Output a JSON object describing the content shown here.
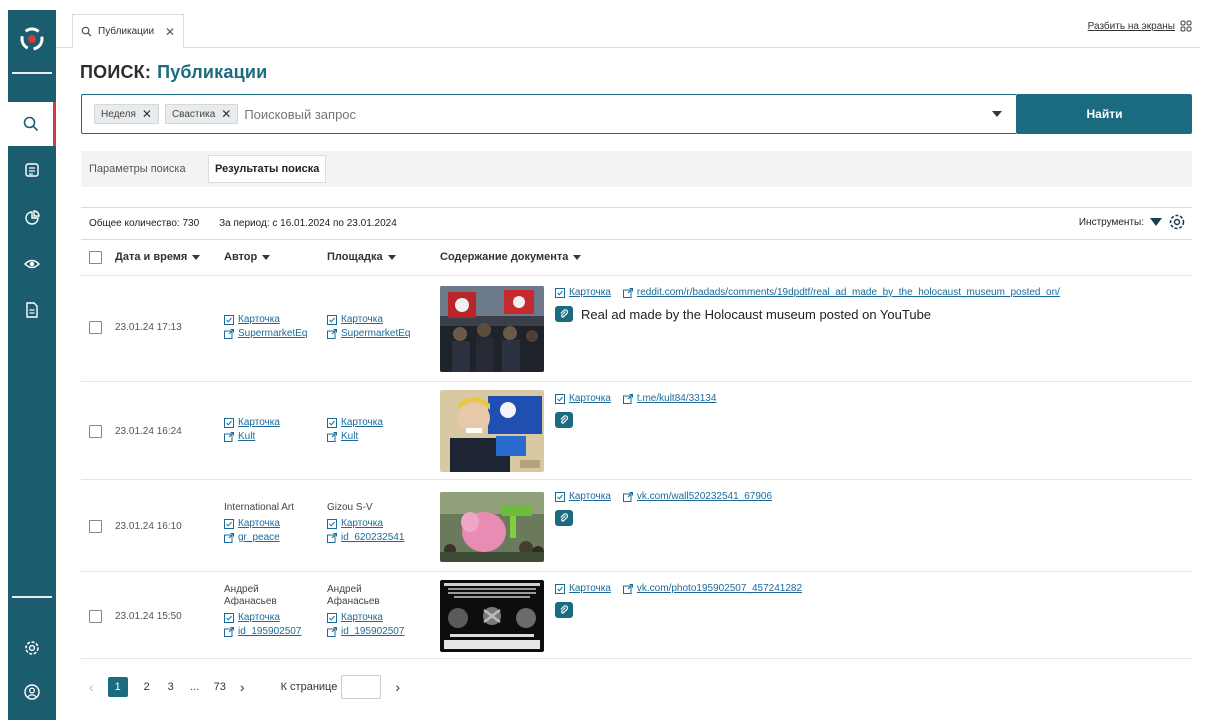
{
  "tab": {
    "label": "Публикации",
    "close": "✕"
  },
  "split": {
    "label": "Разбить на экраны"
  },
  "title": {
    "prefix": "ПОИСК:",
    "section": "Публикации"
  },
  "search": {
    "chips": [
      {
        "label": "Неделя",
        "close": "✕"
      },
      {
        "label": "Свастика",
        "close": "✕"
      }
    ],
    "placeholder": "Поисковый запрос",
    "button": "Найти"
  },
  "subtabs": {
    "params": "Параметры поиска",
    "results": "Результаты поиска"
  },
  "summary": {
    "total": "Общее количество: 730",
    "period": "За период: с 16.01.2024 по 23.01.2024",
    "tools": "Инструменты:"
  },
  "columns": {
    "datetime": "Дата и время",
    "author": "Автор",
    "platform": "Площадка",
    "content": "Содержание документа"
  },
  "card_label": "Карточка",
  "rows": [
    {
      "date": "23.01.24 17:13",
      "author_name": "",
      "author_card": "Карточка",
      "author_link": "SupermarketEq",
      "platform_name": "",
      "platform_card": "Карточка",
      "platform_link": "SupermarketEq",
      "content_card": "Карточка",
      "content_url": "reddit.com/r/badads/comments/19dpdtf/real_ad_made_by_the_holocaust_museum_posted_on/",
      "text": "Real ad made by the Holocaust museum posted on YouTube"
    },
    {
      "date": "23.01.24 16:24",
      "author_name": "",
      "author_card": "Карточка",
      "author_link": "Kult",
      "platform_name": "",
      "platform_card": "Карточка",
      "platform_link": "Kult",
      "content_card": "Карточка",
      "content_url": "t.me/kult84/33134",
      "text": ""
    },
    {
      "date": "23.01.24 16:10",
      "author_name": "International Art",
      "author_card": "Карточка",
      "author_link": "gr_peace",
      "platform_name": "Gizou S-V",
      "platform_card": "Карточка",
      "platform_link": "id_620232541",
      "content_card": "Карточка",
      "content_url": "vk.com/wall520232541_67906",
      "text": ""
    },
    {
      "date": "23.01.24 15:50",
      "author_name": "Андрей\nАфанасьев",
      "author_card": "Карточка",
      "author_link": "id_195902507",
      "platform_name": "Андрей\nАфанасьев",
      "platform_card": "Карточка",
      "platform_link": "id_195902507",
      "content_card": "Карточка",
      "content_url": "vk.com/photo195902507_457241282",
      "text": ""
    }
  ],
  "pager": {
    "pages": [
      "1",
      "2",
      "3",
      "...",
      "73"
    ],
    "per_page": "К странице"
  },
  "colors": {
    "primary": "#1b6b80",
    "sidebar": "#1b5c6e",
    "link": "#1b6b9a",
    "accent_red": "#d43a3a"
  }
}
